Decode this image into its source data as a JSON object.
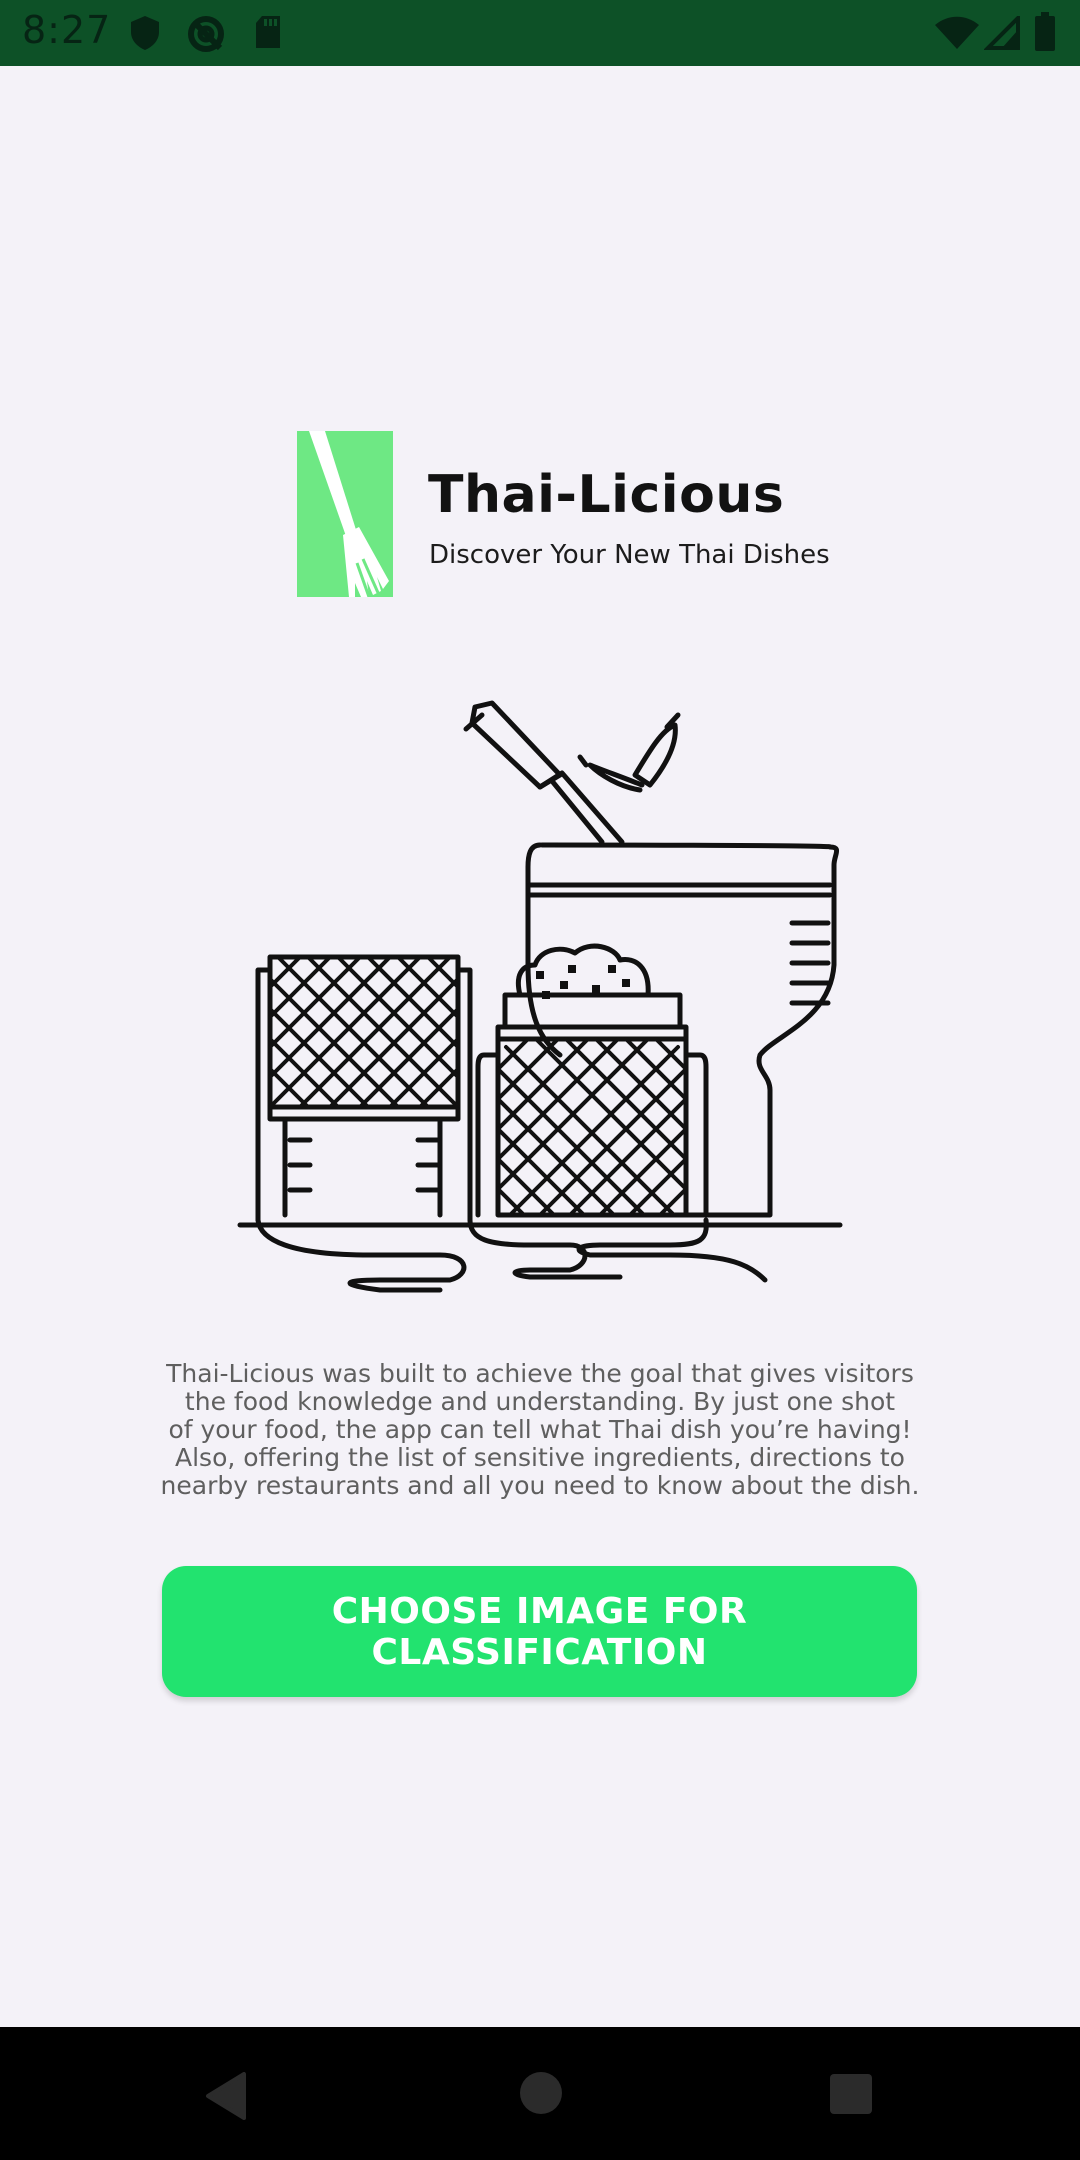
{
  "status_bar": {
    "time": "8:27",
    "background": "#0d5127",
    "icons_left": [
      "shield-icon",
      "sync-blocked-icon",
      "sd-card-icon"
    ],
    "icons_right": [
      "wifi-icon",
      "signal-icon",
      "battery-icon"
    ]
  },
  "header": {
    "title": "Thai-Licious",
    "subtitle": "Discover Your New Thai Dishes",
    "logo_icon": "fork-icon",
    "logo_color": "#6ee884"
  },
  "illustration": {
    "icon": "thai-cooking-illustration-icon"
  },
  "description": {
    "lines": [
      "Thai-Licious was built to achieve the goal that gives visitors",
      "the food knowledge and understanding. By just one shot",
      "of your food, the app can tell what Thai dish you’re having!",
      "Also, offering the list of sensitive ingredients, directions to",
      "nearby restaurants and all you need to know about the dish."
    ]
  },
  "cta": {
    "label": "CHOOSE IMAGE FOR CLASSIFICATION",
    "color": "#22e36f"
  },
  "nav_bar": {
    "buttons": [
      "back-icon",
      "home-icon",
      "recents-icon"
    ]
  }
}
